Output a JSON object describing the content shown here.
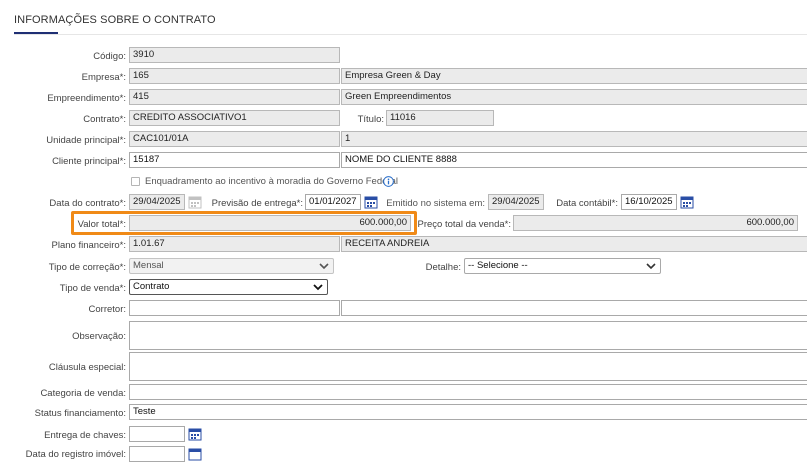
{
  "section": {
    "title": "INFORMAÇÕES SOBRE O CONTRATO"
  },
  "fields": {
    "codigo": {
      "label": "Código:",
      "value": "3910"
    },
    "empresa": {
      "label": "Empresa*:",
      "code": "165",
      "name": "Empresa Green & Day"
    },
    "empreendimento": {
      "label": "Empreendimento*:",
      "code": "415",
      "name": "Green Empreendimentos"
    },
    "contrato": {
      "label": "Contrato*:",
      "value": "CREDITO ASSOCIATIVO1"
    },
    "titulo": {
      "label": "Título:",
      "value": "11016"
    },
    "unidade_principal": {
      "label": "Unidade principal*:",
      "code": "CAC101/01A",
      "name": "1"
    },
    "cliente_principal": {
      "label": "Cliente principal*:",
      "code": "15187",
      "name": "NOME DO CLIENTE 8888"
    },
    "enquadramento": {
      "label": "Enquadramento ao incentivo à moradia do Governo Federal"
    },
    "data_contrato": {
      "label": "Data do contrato*:",
      "value": "29/04/2025"
    },
    "previsao_entrega": {
      "label": "Previsão de entrega*:",
      "value": "01/01/2027"
    },
    "emitido_sistema": {
      "label": "Emitido no sistema em:",
      "value": "29/04/2025"
    },
    "data_contabil": {
      "label": "Data contábil*:",
      "value": "16/10/2025"
    },
    "valor_total": {
      "label": "Valor total*:",
      "value": "600.000,00"
    },
    "preco_total_venda": {
      "label": "Preço total da venda*:",
      "value": "600.000,00"
    },
    "plano_financeiro": {
      "label": "Plano financeiro*:",
      "code": "1.01.67",
      "name": "RECEITA ANDREIA"
    },
    "tipo_correcao": {
      "label": "Tipo de correção*:",
      "value": "Mensal"
    },
    "detalhe": {
      "label": "Detalhe:",
      "value": "-- Selecione --"
    },
    "tipo_venda": {
      "label": "Tipo de venda*:",
      "value": "Contrato"
    },
    "corretor": {
      "label": "Corretor:",
      "value": ""
    },
    "observacao": {
      "label": "Observação:",
      "value": ""
    },
    "clausula_especial": {
      "label": "Cláusula especial:",
      "value": ""
    },
    "categoria_venda": {
      "label": "Categoria de venda:",
      "value": ""
    },
    "status_financiamento": {
      "label": "Status financiamento:",
      "value": "Teste"
    },
    "entrega_chaves": {
      "label": "Entrega de chaves:",
      "value": ""
    },
    "data_registro_imovel": {
      "label": "Data do registro imóvel:",
      "value": ""
    }
  },
  "colors": {
    "highlight": "#f08a17",
    "calendar_icon": "#2a4ea6",
    "title_accent": "#1f2f74"
  },
  "icons": {
    "calendar": "calendar-icon",
    "info": "info-icon",
    "dropdown": "chevron-down-icon"
  }
}
